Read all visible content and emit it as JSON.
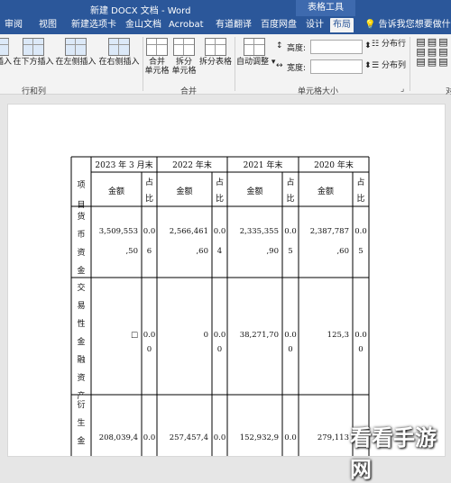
{
  "window": {
    "title": "新建 DOCX 文档 - Word",
    "context_tab": "表格工具"
  },
  "tabs": [
    "审阅",
    "视图",
    "新建选项卡",
    "金山文档",
    "Acrobat",
    "有道翻译",
    "百度网盘",
    "设计",
    "布局"
  ],
  "tell_me": "告诉我您想要做什么",
  "ribbon": {
    "insert_below": "在下方插入",
    "insert_left": "在左侧插入",
    "insert_right": "在右侧插入",
    "insert_above_partial": "插入",
    "merge_cells": [
      "合并",
      "单元格"
    ],
    "split_cells": [
      "拆分",
      "单元格"
    ],
    "split_table": "拆分表格",
    "autofit": "自动调整",
    "height_label": "高度:",
    "width_label": "宽度:",
    "distribute_rows": "分布行",
    "distribute_cols": "分布列",
    "group_rows_cols": "行和列",
    "group_merge": "合并",
    "group_cell_size": "单元格大小",
    "group_align_partial": "对"
  },
  "table": {
    "header_item": "项目",
    "periods": [
      "2023 年 3 月末",
      "2022 年末",
      "2021 年末",
      "2020 年末"
    ],
    "sub_amount": "金额",
    "sub_ratio": "占比",
    "rows": [
      {
        "label": "货币资金",
        "amounts": [
          [
            "3,509,553",
            ",50"
          ],
          [
            "2,566,461",
            ",60"
          ],
          [
            "2,335,355",
            ",90"
          ],
          [
            "2,387,787",
            ",60"
          ]
        ],
        "ratios": [
          [
            "0.0",
            "6"
          ],
          [
            "0.0",
            "4"
          ],
          [
            "0.0",
            "5"
          ],
          [
            "0.0",
            "5"
          ]
        ]
      },
      {
        "label": "交易性金融资产",
        "amounts": [
          [
            "□",
            ""
          ],
          [
            "0",
            ""
          ],
          [
            "38,271,70",
            ""
          ],
          [
            "125,3",
            ""
          ]
        ],
        "ratios": [
          [
            "0.0",
            "0"
          ],
          [
            "0.0",
            "0"
          ],
          [
            "0.0",
            "0"
          ],
          [
            "0.0",
            "0"
          ]
        ]
      },
      {
        "label": "衍生金",
        "amounts": [
          [
            "208,039,4",
            ""
          ],
          [
            "257,457,4",
            ""
          ],
          [
            "152,932,9",
            ""
          ],
          [
            "279,113",
            ""
          ]
        ],
        "ratios": [
          [
            "0.0",
            ""
          ],
          [
            "0.0",
            ""
          ],
          [
            "0.0",
            ""
          ],
          [
            "0.0",
            ""
          ]
        ]
      }
    ]
  },
  "watermark": "看看手游网",
  "colors": {
    "word_blue": "#2b579a",
    "ribbon_bg": "#f3f3f3",
    "doc_bg": "#e6e6e6"
  }
}
